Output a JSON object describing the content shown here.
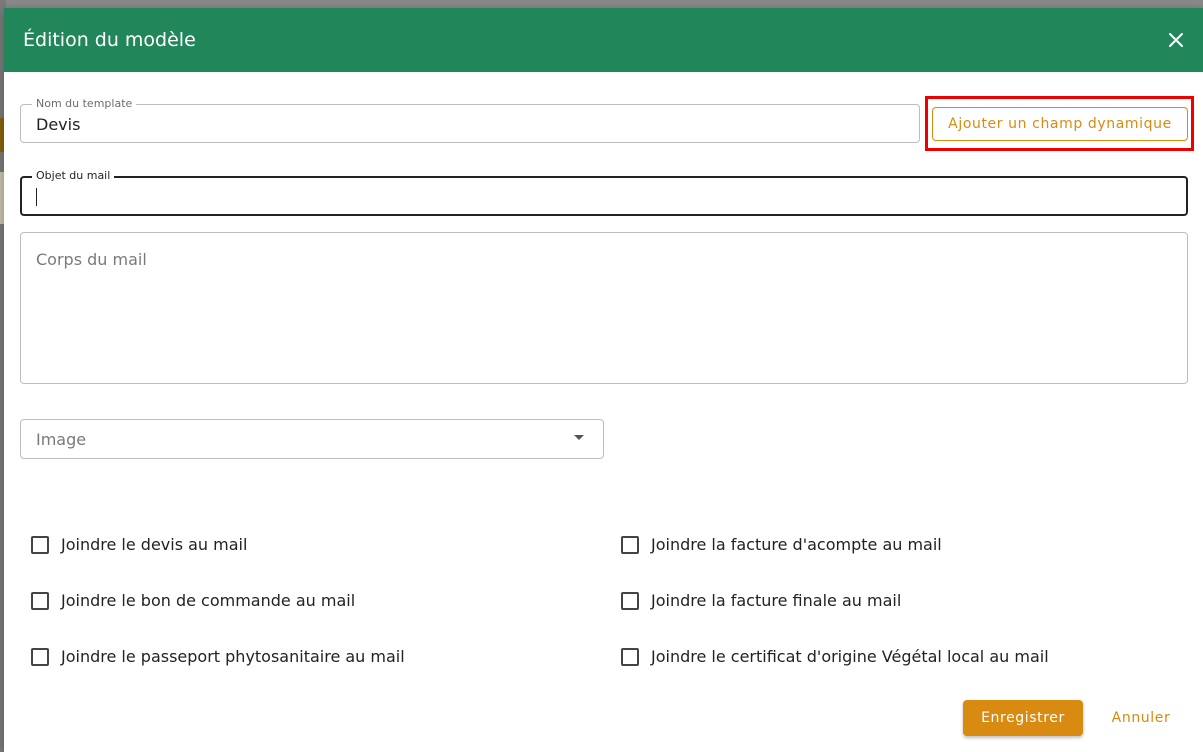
{
  "dialog": {
    "title": "Édition du modèle",
    "close_icon": "close-icon"
  },
  "form": {
    "template_name": {
      "label": "Nom du template",
      "value": "Devis"
    },
    "dynamic_field_button": "Ajouter un champ dynamique",
    "subject": {
      "label": "Objet du mail",
      "value": ""
    },
    "body": {
      "placeholder": "Corps du mail",
      "value": ""
    },
    "image": {
      "placeholder": "Image"
    }
  },
  "checkboxes": [
    {
      "label": "Joindre le devis au mail",
      "checked": false
    },
    {
      "label": "Joindre la facture d'acompte au mail",
      "checked": false
    },
    {
      "label": "Joindre le bon de commande au mail",
      "checked": false
    },
    {
      "label": "Joindre la facture finale au mail",
      "checked": false
    },
    {
      "label": "Joindre le passeport phytosanitaire au mail",
      "checked": false
    },
    {
      "label": "Joindre le certificat d'origine Végétal local au mail",
      "checked": false
    }
  ],
  "actions": {
    "save": "Enregistrer",
    "cancel": "Annuler"
  },
  "colors": {
    "header": "#21865a",
    "accent": "#d98a11",
    "highlight": "#ee0000"
  }
}
